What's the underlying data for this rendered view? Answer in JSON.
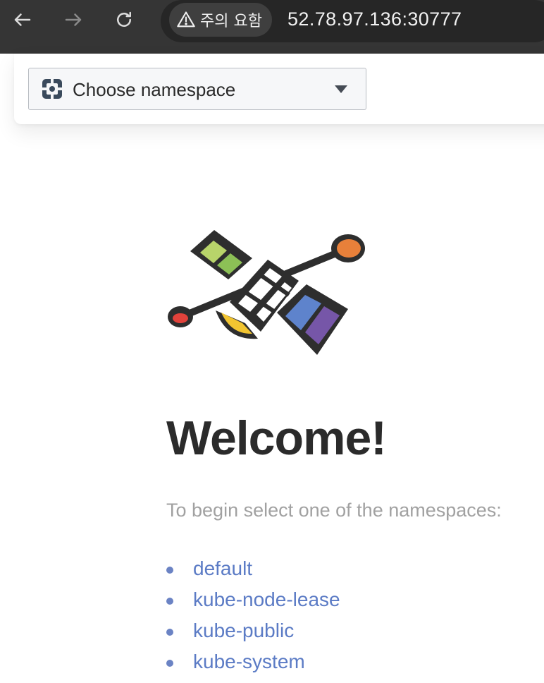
{
  "browser": {
    "security_label": "주의 요함",
    "url": "52.78.97.136:30777",
    "back_icon": "arrow-left-icon",
    "forward_icon": "arrow-right-icon",
    "reload_icon": "reload-icon",
    "warning_icon": "warning-triangle-icon"
  },
  "toolbar": {
    "namespace_select": {
      "placeholder": "Choose namespace",
      "icon": "namespace-icon",
      "caret_icon": "caret-down-icon"
    }
  },
  "main": {
    "logo_icon": "satellite-logo-icon",
    "title": "Welcome!",
    "subtitle": "To begin select one of the namespaces:",
    "namespaces": [
      {
        "label": "default"
      },
      {
        "label": "kube-node-lease"
      },
      {
        "label": "kube-public"
      },
      {
        "label": "kube-system"
      }
    ]
  },
  "colors": {
    "link": "#5b7bc5",
    "title": "#2b2b2b",
    "subtitle": "#a1a1a1",
    "browser_bar": "#353535"
  }
}
